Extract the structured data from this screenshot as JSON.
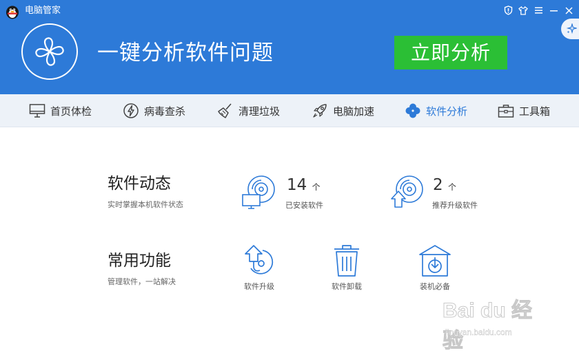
{
  "window": {
    "title": "电脑管家"
  },
  "hero": {
    "headline": "一键分析软件问题",
    "button_label": "立即分析"
  },
  "nav": {
    "tabs": [
      {
        "label": "首页体检",
        "icon": "monitor-icon"
      },
      {
        "label": "病毒查杀",
        "icon": "lightning-shield-icon"
      },
      {
        "label": "清理垃圾",
        "icon": "broom-icon"
      },
      {
        "label": "电脑加速",
        "icon": "rocket-icon"
      },
      {
        "label": "软件分析",
        "icon": "clover-icon",
        "active": true
      },
      {
        "label": "工具箱",
        "icon": "toolbox-icon"
      }
    ]
  },
  "software_status": {
    "title": "软件动态",
    "subtitle": "实时掌握本机软件状态",
    "installed": {
      "count": "14",
      "unit": "个",
      "label": "已安装软件"
    },
    "recommended": {
      "count": "2",
      "unit": "个",
      "label": "推荐升级软件"
    }
  },
  "common_functions": {
    "title": "常用功能",
    "subtitle": "管理软件，一站解决",
    "items": [
      {
        "label": "软件升级",
        "icon": "upgrade-icon"
      },
      {
        "label": "软件卸载",
        "icon": "trash-icon"
      },
      {
        "label": "装机必备",
        "icon": "install-box-icon"
      }
    ]
  },
  "watermark": {
    "logo_text": "Bai du 经验",
    "url": "jingyan.baidu.com"
  },
  "colors": {
    "header_blue": "#2d7ad8",
    "action_green": "#2bbf35",
    "nav_bg": "#edf2f8",
    "active_tab": "#2d7ad8"
  }
}
